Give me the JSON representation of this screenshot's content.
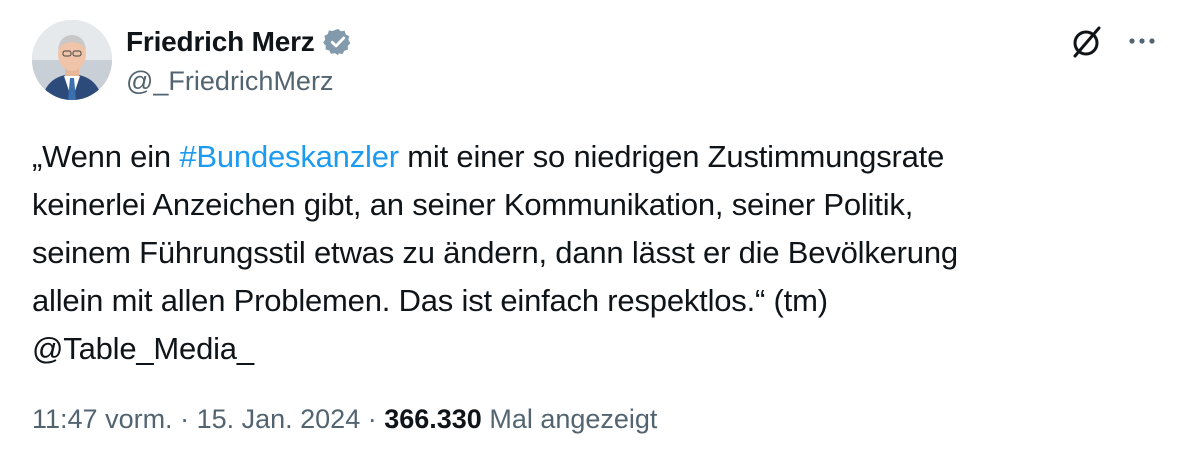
{
  "author": {
    "display_name": "Friedrich Merz",
    "handle": "@_FriedrichMerz",
    "verified": true
  },
  "icons": {
    "avatar": "profile-photo",
    "verified": "verified-badge-icon",
    "grok": "grok-slash-icon",
    "more": "more-options-icon"
  },
  "tweet": {
    "line1_prefix": "„Wenn ein ",
    "hashtag": "#Bundeskanzler",
    "line1_suffix": " mit einer so niedrigen Zustimmungsrate",
    "line2": "keinerlei Anzeichen gibt, an seiner Kommunikation, seiner Politik,",
    "line3": "seinem Führungsstil etwas zu ändern, dann lässt er die Bevölkerung",
    "line4": "allein mit allen Problemen. Das ist einfach respektlos.“ (tm)",
    "line5": "@Table_Media_"
  },
  "meta": {
    "time": "11:47 vorm.",
    "sep1": " · ",
    "date": "15. Jan. 2024",
    "sep2": " · ",
    "views_count": "366.330",
    "views_label": " Mal angezeigt"
  },
  "colors": {
    "link": "#1d9bf0",
    "secondary_text": "#536471",
    "primary_text": "#0f1419",
    "verified_badge": "#829aab"
  }
}
